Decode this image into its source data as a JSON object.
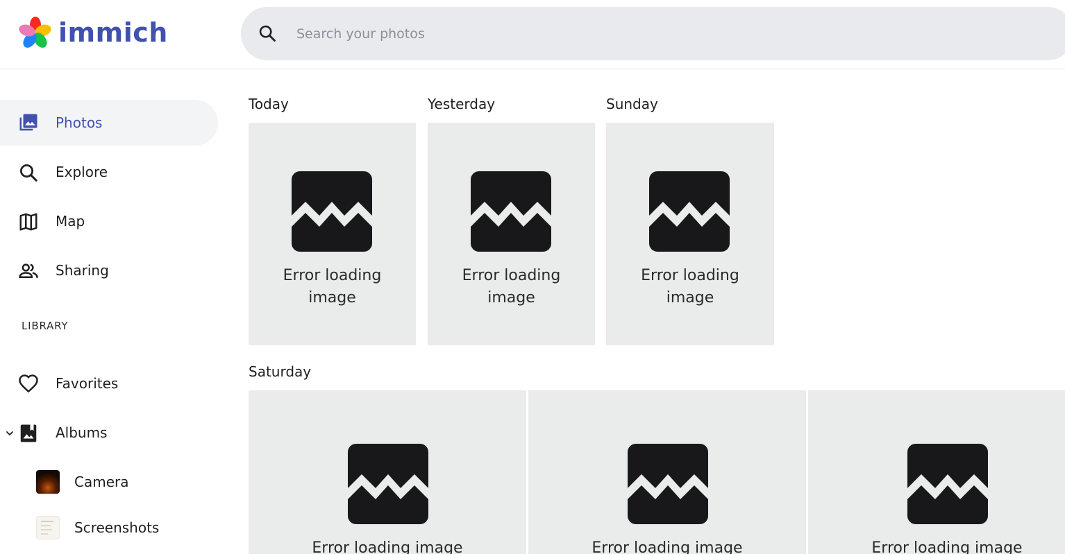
{
  "app": {
    "name": "immich"
  },
  "search": {
    "placeholder": "Search your photos"
  },
  "sidebar": {
    "items": [
      {
        "label": "Photos",
        "icon": "photos-icon",
        "active": true
      },
      {
        "label": "Explore",
        "icon": "search-icon"
      },
      {
        "label": "Map",
        "icon": "map-icon"
      },
      {
        "label": "Sharing",
        "icon": "people-icon"
      }
    ],
    "library_title": "LIBRARY",
    "library": [
      {
        "label": "Favorites",
        "icon": "heart-icon"
      },
      {
        "label": "Albums",
        "icon": "album-icon",
        "expanded": true
      }
    ],
    "albums": [
      {
        "label": "Camera"
      },
      {
        "label": "Screenshots"
      }
    ]
  },
  "timeline": {
    "groups": [
      {
        "title": "Today",
        "tiles": [
          {
            "error": "Error loading image"
          }
        ]
      },
      {
        "title": "Yesterday",
        "tiles": [
          {
            "error": "Error loading image"
          }
        ]
      },
      {
        "title": "Sunday",
        "tiles": [
          {
            "error": "Error loading image"
          }
        ]
      },
      {
        "title": "Saturday",
        "tiles": [
          {
            "error": "Error loading image"
          },
          {
            "error": "Error loading image"
          },
          {
            "error": "Error loading image"
          }
        ]
      }
    ]
  },
  "colors": {
    "brand": "#4250af",
    "tile_bg": "#eaebeb",
    "search_bg": "#e8eaee",
    "active_nav_bg": "#f3f4f6"
  }
}
